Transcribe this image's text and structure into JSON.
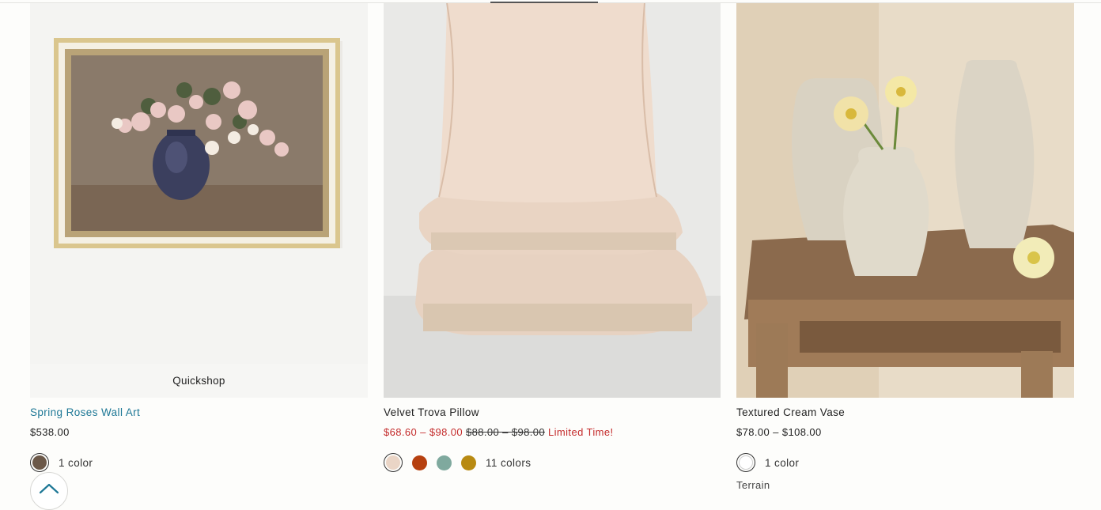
{
  "products": [
    {
      "name": "Spring Roses Wall Art",
      "price": "$538.00",
      "quickshop_label": "Quickshop",
      "swatches": [
        "#6b5848"
      ],
      "colors_label": "1 color"
    },
    {
      "name": "Velvet Trova Pillow",
      "sale_price": "$68.60 – $98.00",
      "original_price": "$88.00 – $98.00",
      "promo_label": "Limited Time!",
      "swatches": [
        "#ead5c6",
        "#b6400f",
        "#7fa99e",
        "#b88a12"
      ],
      "colors_label": "11 colors"
    },
    {
      "name": "Textured Cream Vase",
      "price": "$78.00 – $108.00",
      "swatches": [
        "#ffffff"
      ],
      "colors_label": "1 color",
      "brand": "Terrain"
    }
  ],
  "colors": {
    "link": "#1e7896",
    "sale": "#c42b2b"
  },
  "icons": {
    "back_to_top": "chevron-up-icon"
  }
}
